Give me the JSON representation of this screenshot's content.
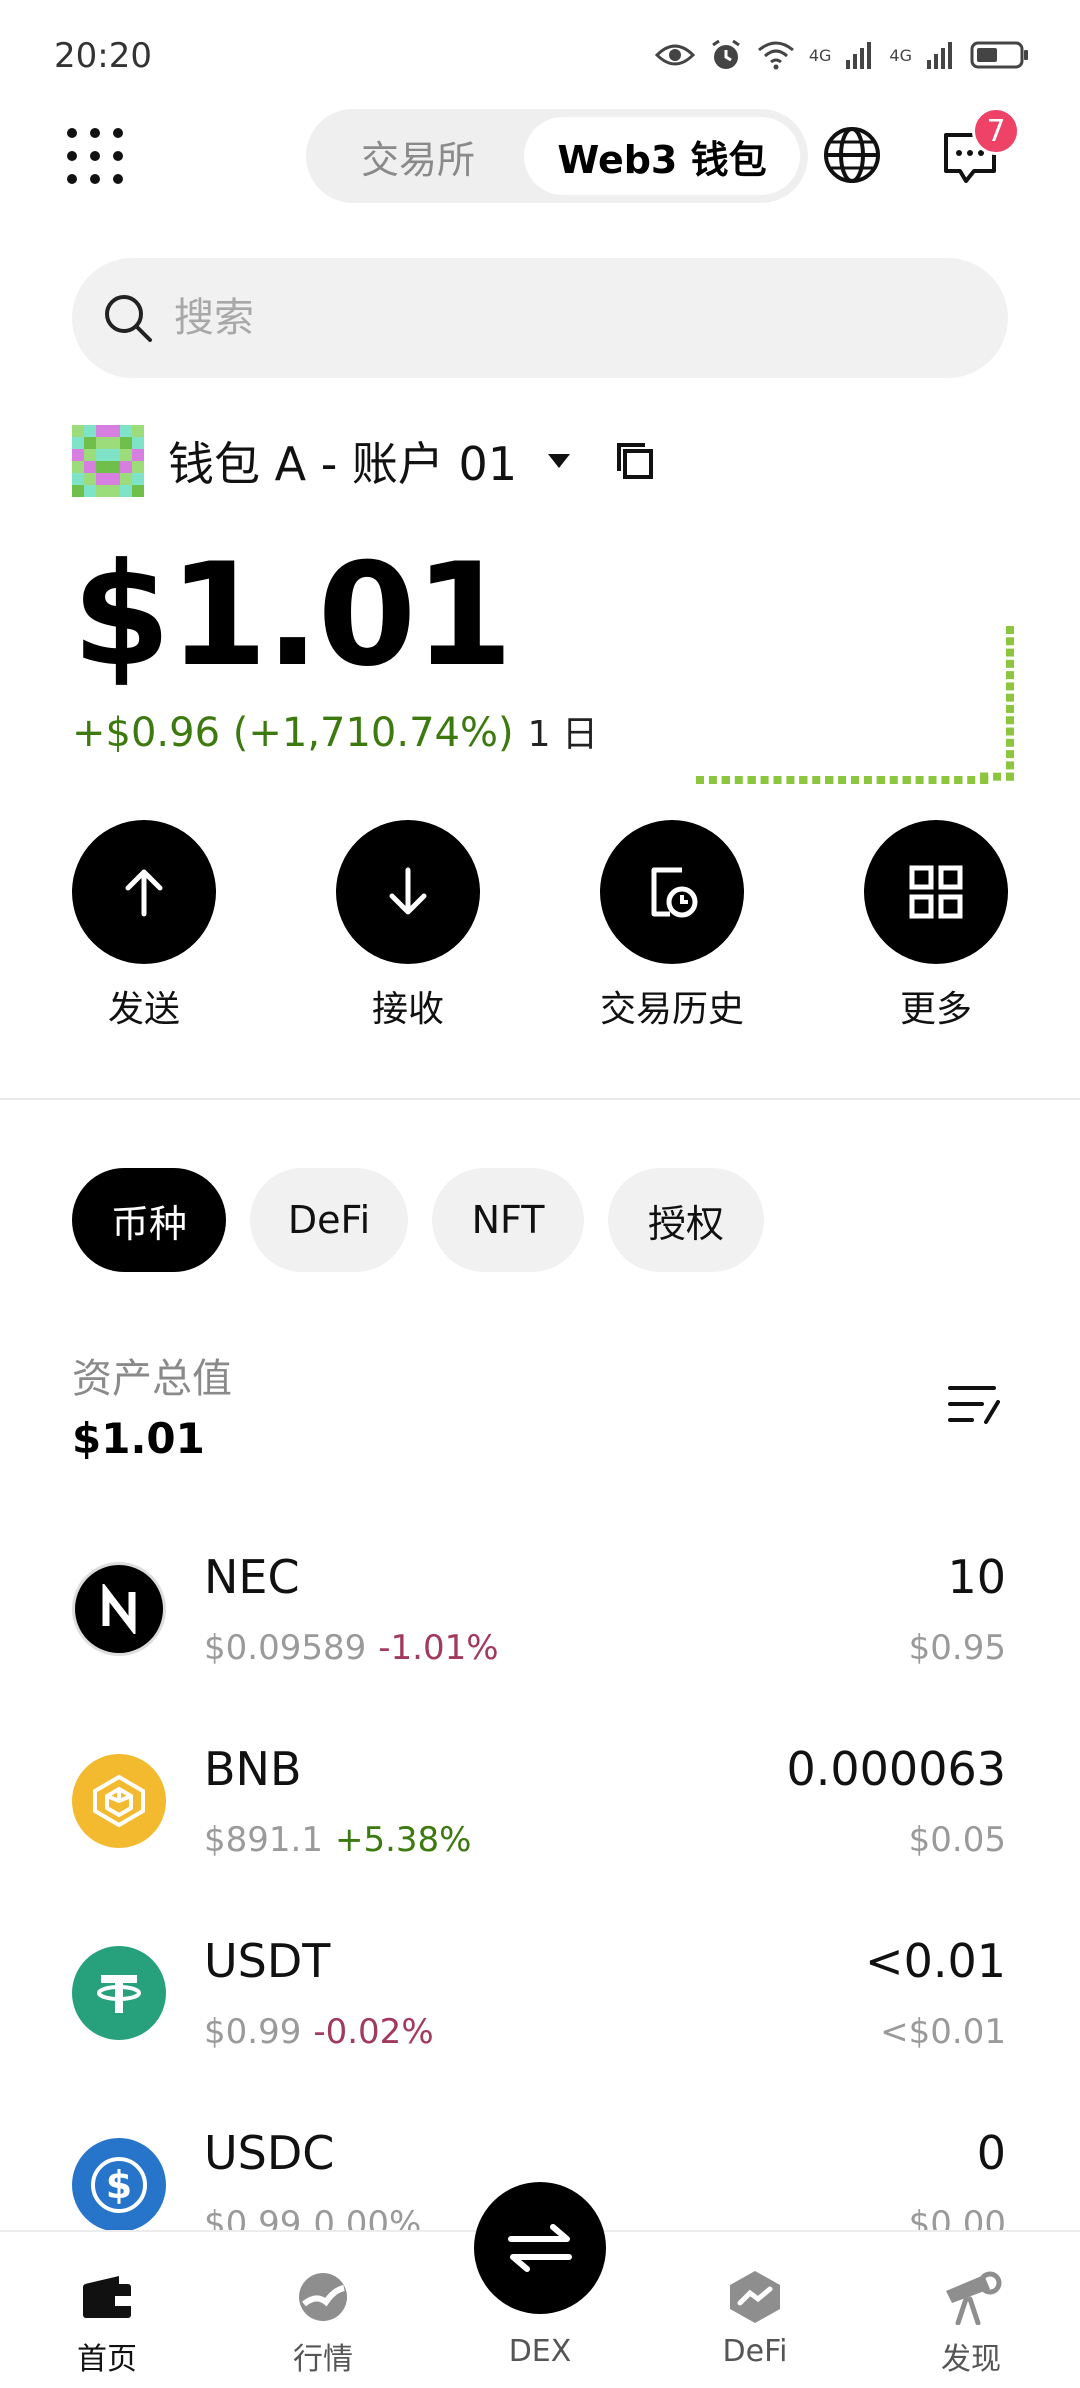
{
  "status": {
    "time": "20:20",
    "net1": "4G",
    "net2": "4G"
  },
  "header": {
    "tabs": [
      {
        "label": "交易所",
        "active": false
      },
      {
        "label": "Web3 钱包",
        "active": true
      }
    ],
    "message_badge": "7"
  },
  "search": {
    "placeholder": "搜索"
  },
  "wallet": {
    "name": "钱包 A - 账户 01",
    "balance": "$1.01",
    "change": "+$0.96 (+1,710.74%)",
    "period": "1 日",
    "positive_color": "#3c7a0f",
    "spark": [
      0,
      0,
      0,
      0,
      0,
      0,
      0,
      0,
      0,
      0,
      0,
      0.02,
      0.9
    ]
  },
  "actions": [
    {
      "label": "发送",
      "icon": "arrow-up-icon"
    },
    {
      "label": "接收",
      "icon": "arrow-down-icon"
    },
    {
      "label": "交易历史",
      "icon": "history-icon"
    },
    {
      "label": "更多",
      "icon": "grid-icon"
    }
  ],
  "filters": [
    {
      "label": "币种",
      "active": true
    },
    {
      "label": "DeFi",
      "active": false
    },
    {
      "label": "NFT",
      "active": false
    },
    {
      "label": "授权",
      "active": false
    }
  ],
  "portfolio": {
    "total_label": "资产总值",
    "total_value": "$1.01"
  },
  "assets": [
    {
      "symbol": "NEC",
      "price": "$0.09589",
      "change": "-1.01%",
      "trend": "neg",
      "amount": "10",
      "value": "$0.95",
      "logo_color": "#000000",
      "icon": "nec-logo-icon"
    },
    {
      "symbol": "BNB",
      "price": "$891.1",
      "change": "+5.38%",
      "trend": "pos",
      "amount": "0.000063",
      "value": "$0.05",
      "logo_color": "#f3ba2f",
      "icon": "bnb-logo-icon"
    },
    {
      "symbol": "USDT",
      "price": "$0.99",
      "change": "-0.02%",
      "trend": "neg",
      "amount": "<0.01",
      "value": "<$0.01",
      "logo_color": "#26a17b",
      "icon": "usdt-logo-icon"
    },
    {
      "symbol": "USDC",
      "price": "$0.99",
      "change": "0.00%",
      "trend": "neu",
      "amount": "0",
      "value": "$0.00",
      "logo_color": "#2775ca",
      "icon": "usdc-logo-icon"
    }
  ],
  "nav": [
    {
      "label": "首页",
      "icon": "wallet-icon",
      "active": true
    },
    {
      "label": "行情",
      "icon": "market-icon",
      "active": false
    },
    {
      "label": "DEX",
      "icon": "swap-icon",
      "active": false
    },
    {
      "label": "DeFi",
      "icon": "defi-icon",
      "active": false
    },
    {
      "label": "发现",
      "icon": "discover-icon",
      "active": false
    }
  ]
}
